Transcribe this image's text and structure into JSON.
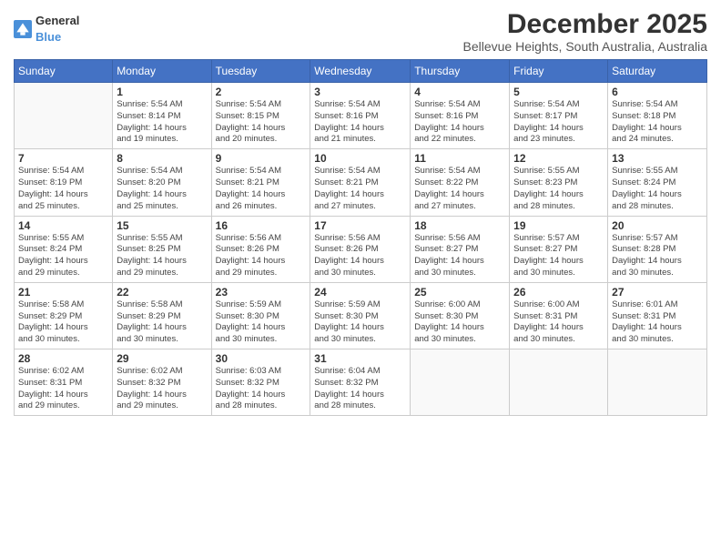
{
  "header": {
    "logo_general": "General",
    "logo_blue": "Blue",
    "title": "December 2025",
    "subtitle": "Bellevue Heights, South Australia, Australia"
  },
  "calendar": {
    "headers": [
      "Sunday",
      "Monday",
      "Tuesday",
      "Wednesday",
      "Thursday",
      "Friday",
      "Saturday"
    ],
    "weeks": [
      [
        {
          "day": "",
          "detail": ""
        },
        {
          "day": "1",
          "detail": "Sunrise: 5:54 AM\nSunset: 8:14 PM\nDaylight: 14 hours\nand 19 minutes."
        },
        {
          "day": "2",
          "detail": "Sunrise: 5:54 AM\nSunset: 8:15 PM\nDaylight: 14 hours\nand 20 minutes."
        },
        {
          "day": "3",
          "detail": "Sunrise: 5:54 AM\nSunset: 8:16 PM\nDaylight: 14 hours\nand 21 minutes."
        },
        {
          "day": "4",
          "detail": "Sunrise: 5:54 AM\nSunset: 8:16 PM\nDaylight: 14 hours\nand 22 minutes."
        },
        {
          "day": "5",
          "detail": "Sunrise: 5:54 AM\nSunset: 8:17 PM\nDaylight: 14 hours\nand 23 minutes."
        },
        {
          "day": "6",
          "detail": "Sunrise: 5:54 AM\nSunset: 8:18 PM\nDaylight: 14 hours\nand 24 minutes."
        }
      ],
      [
        {
          "day": "7",
          "detail": "Sunrise: 5:54 AM\nSunset: 8:19 PM\nDaylight: 14 hours\nand 25 minutes."
        },
        {
          "day": "8",
          "detail": "Sunrise: 5:54 AM\nSunset: 8:20 PM\nDaylight: 14 hours\nand 25 minutes."
        },
        {
          "day": "9",
          "detail": "Sunrise: 5:54 AM\nSunset: 8:21 PM\nDaylight: 14 hours\nand 26 minutes."
        },
        {
          "day": "10",
          "detail": "Sunrise: 5:54 AM\nSunset: 8:21 PM\nDaylight: 14 hours\nand 27 minutes."
        },
        {
          "day": "11",
          "detail": "Sunrise: 5:54 AM\nSunset: 8:22 PM\nDaylight: 14 hours\nand 27 minutes."
        },
        {
          "day": "12",
          "detail": "Sunrise: 5:55 AM\nSunset: 8:23 PM\nDaylight: 14 hours\nand 28 minutes."
        },
        {
          "day": "13",
          "detail": "Sunrise: 5:55 AM\nSunset: 8:24 PM\nDaylight: 14 hours\nand 28 minutes."
        }
      ],
      [
        {
          "day": "14",
          "detail": "Sunrise: 5:55 AM\nSunset: 8:24 PM\nDaylight: 14 hours\nand 29 minutes."
        },
        {
          "day": "15",
          "detail": "Sunrise: 5:55 AM\nSunset: 8:25 PM\nDaylight: 14 hours\nand 29 minutes."
        },
        {
          "day": "16",
          "detail": "Sunrise: 5:56 AM\nSunset: 8:26 PM\nDaylight: 14 hours\nand 29 minutes."
        },
        {
          "day": "17",
          "detail": "Sunrise: 5:56 AM\nSunset: 8:26 PM\nDaylight: 14 hours\nand 30 minutes."
        },
        {
          "day": "18",
          "detail": "Sunrise: 5:56 AM\nSunset: 8:27 PM\nDaylight: 14 hours\nand 30 minutes."
        },
        {
          "day": "19",
          "detail": "Sunrise: 5:57 AM\nSunset: 8:27 PM\nDaylight: 14 hours\nand 30 minutes."
        },
        {
          "day": "20",
          "detail": "Sunrise: 5:57 AM\nSunset: 8:28 PM\nDaylight: 14 hours\nand 30 minutes."
        }
      ],
      [
        {
          "day": "21",
          "detail": "Sunrise: 5:58 AM\nSunset: 8:29 PM\nDaylight: 14 hours\nand 30 minutes."
        },
        {
          "day": "22",
          "detail": "Sunrise: 5:58 AM\nSunset: 8:29 PM\nDaylight: 14 hours\nand 30 minutes."
        },
        {
          "day": "23",
          "detail": "Sunrise: 5:59 AM\nSunset: 8:30 PM\nDaylight: 14 hours\nand 30 minutes."
        },
        {
          "day": "24",
          "detail": "Sunrise: 5:59 AM\nSunset: 8:30 PM\nDaylight: 14 hours\nand 30 minutes."
        },
        {
          "day": "25",
          "detail": "Sunrise: 6:00 AM\nSunset: 8:30 PM\nDaylight: 14 hours\nand 30 minutes."
        },
        {
          "day": "26",
          "detail": "Sunrise: 6:00 AM\nSunset: 8:31 PM\nDaylight: 14 hours\nand 30 minutes."
        },
        {
          "day": "27",
          "detail": "Sunrise: 6:01 AM\nSunset: 8:31 PM\nDaylight: 14 hours\nand 30 minutes."
        }
      ],
      [
        {
          "day": "28",
          "detail": "Sunrise: 6:02 AM\nSunset: 8:31 PM\nDaylight: 14 hours\nand 29 minutes."
        },
        {
          "day": "29",
          "detail": "Sunrise: 6:02 AM\nSunset: 8:32 PM\nDaylight: 14 hours\nand 29 minutes."
        },
        {
          "day": "30",
          "detail": "Sunrise: 6:03 AM\nSunset: 8:32 PM\nDaylight: 14 hours\nand 28 minutes."
        },
        {
          "day": "31",
          "detail": "Sunrise: 6:04 AM\nSunset: 8:32 PM\nDaylight: 14 hours\nand 28 minutes."
        },
        {
          "day": "",
          "detail": ""
        },
        {
          "day": "",
          "detail": ""
        },
        {
          "day": "",
          "detail": ""
        }
      ]
    ]
  }
}
